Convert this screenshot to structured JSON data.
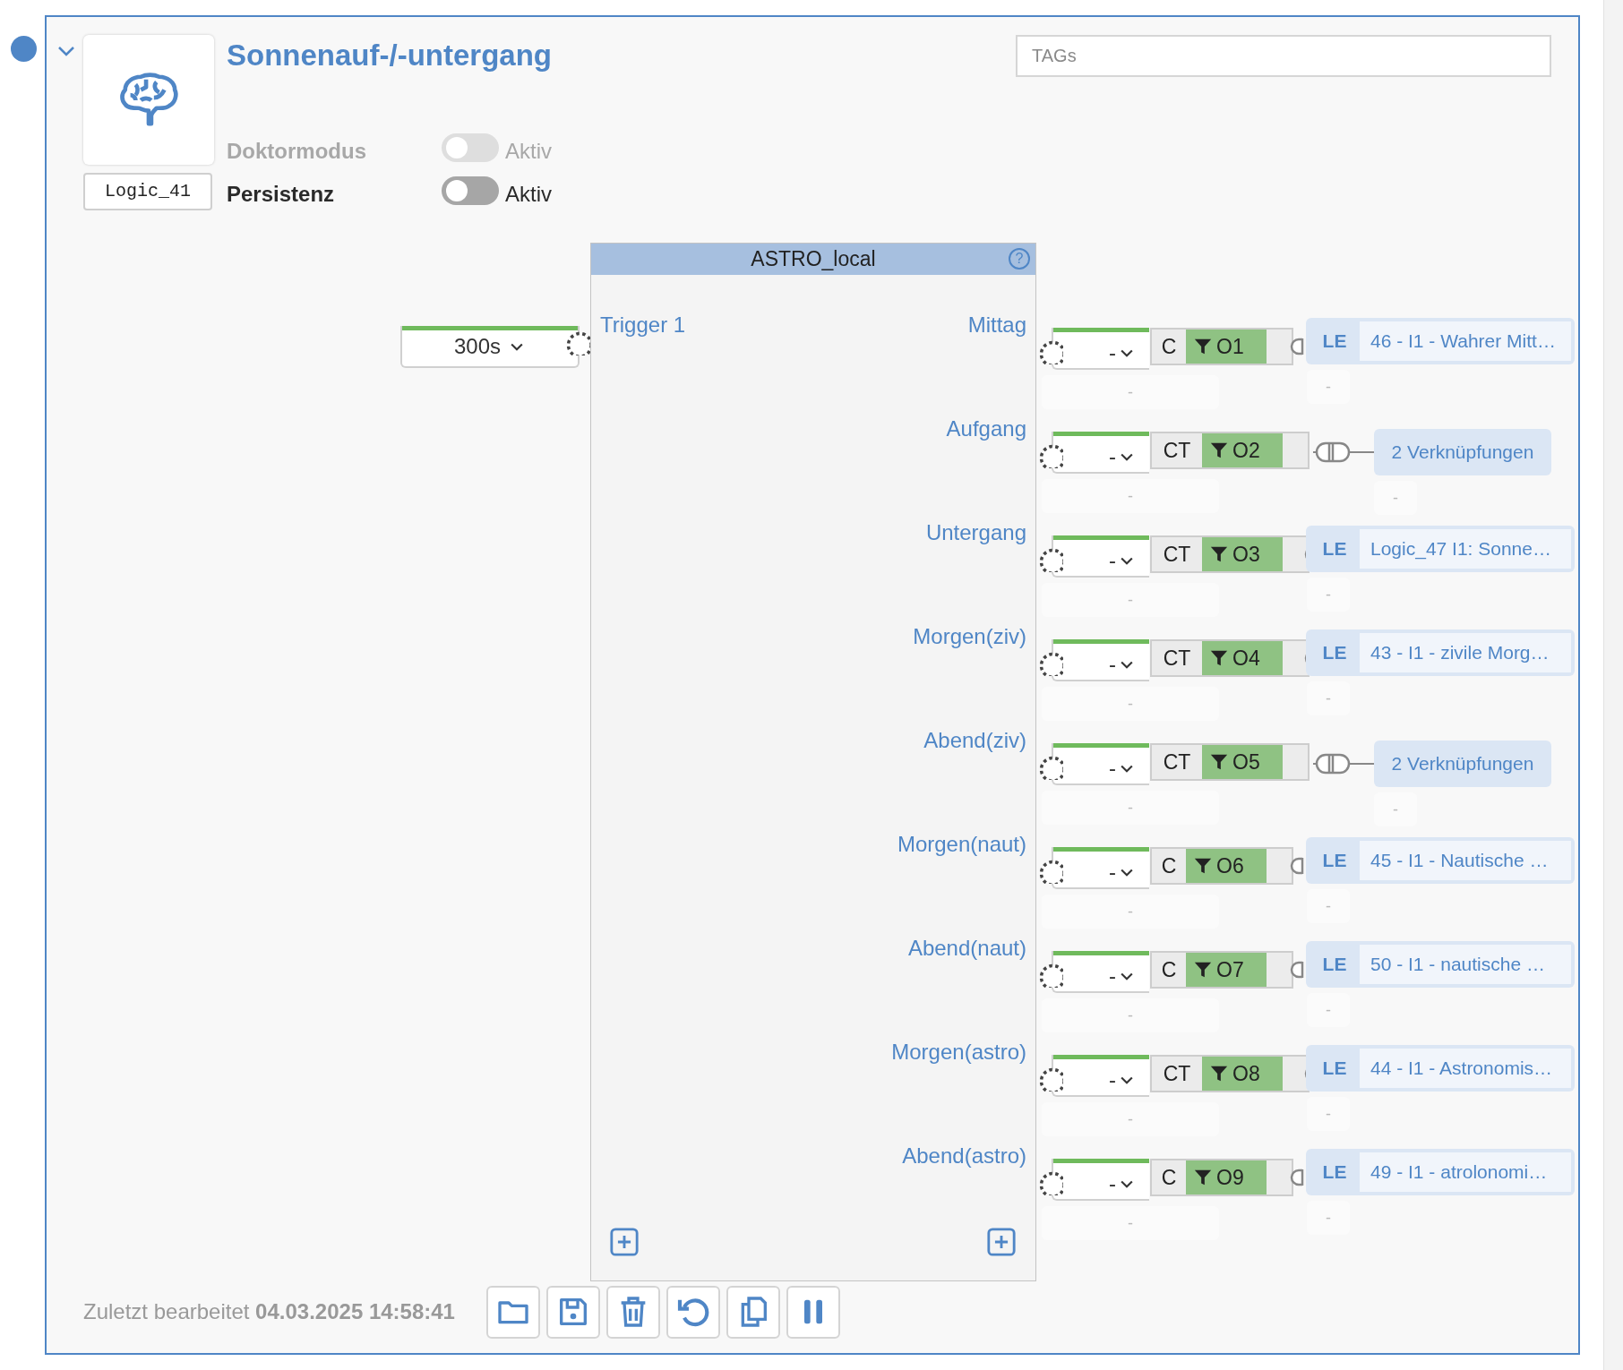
{
  "logic": {
    "title": "Sonnenauf-/-untergang",
    "id": "Logic_41",
    "expanded": true,
    "tags": {
      "placeholder": "TAGs"
    },
    "options": [
      {
        "label": "Doktormodus",
        "toggle_label": "Aktiv",
        "on": false,
        "disabled": true
      },
      {
        "label": "Persistenz",
        "toggle_label": "Aktiv",
        "on": false,
        "disabled": false
      }
    ]
  },
  "block": {
    "title": "ASTRO_local",
    "help": "?",
    "inputs": [
      {
        "label": "Trigger 1",
        "value": "300s"
      }
    ],
    "outputs": [
      {
        "label": "Mittag",
        "value": "-",
        "value_sub": "-",
        "mode": "C",
        "port": "O1",
        "link": {
          "kind": "le",
          "tag": "LE",
          "text": "46 - I1 - Wahrer Mitt…"
        },
        "link_sub": "-"
      },
      {
        "label": "Aufgang",
        "value": "-",
        "value_sub": "-",
        "mode": "CT",
        "port": "O2",
        "link": {
          "kind": "count",
          "text": "2 Verknüpfungen"
        },
        "link_sub": "-"
      },
      {
        "label": "Untergang",
        "value": "-",
        "value_sub": "-",
        "mode": "CT",
        "port": "O3",
        "link": {
          "kind": "le",
          "tag": "LE",
          "text": "Logic_47 I1: Sonne…"
        },
        "link_sub": "-"
      },
      {
        "label": "Morgen(ziv)",
        "value": "-",
        "value_sub": "-",
        "mode": "CT",
        "port": "O4",
        "link": {
          "kind": "le",
          "tag": "LE",
          "text": "43 - I1 - zivile Morg…"
        },
        "link_sub": "-"
      },
      {
        "label": "Abend(ziv)",
        "value": "-",
        "value_sub": "-",
        "mode": "CT",
        "port": "O5",
        "link": {
          "kind": "count",
          "text": "2 Verknüpfungen"
        },
        "link_sub": "-"
      },
      {
        "label": "Morgen(naut)",
        "value": "-",
        "value_sub": "-",
        "mode": "C",
        "port": "O6",
        "link": {
          "kind": "le",
          "tag": "LE",
          "text": "45 - I1 - Nautische …"
        },
        "link_sub": "-"
      },
      {
        "label": "Abend(naut)",
        "value": "-",
        "value_sub": "-",
        "mode": "C",
        "port": "O7",
        "link": {
          "kind": "le",
          "tag": "LE",
          "text": "50 - I1 - nautische …"
        },
        "link_sub": "-"
      },
      {
        "label": "Morgen(astro)",
        "value": "-",
        "value_sub": "-",
        "mode": "CT",
        "port": "O8",
        "link": {
          "kind": "le",
          "tag": "LE",
          "text": "44 - I1 - Astronomis…"
        },
        "link_sub": "-"
      },
      {
        "label": "Abend(astro)",
        "value": "-",
        "value_sub": "-",
        "mode": "C",
        "port": "O9",
        "link": {
          "kind": "le",
          "tag": "LE",
          "text": "49 - I1 - atrolonomi…"
        },
        "link_sub": "-"
      }
    ]
  },
  "footer": {
    "text": "Zuletzt bearbeitet **04.03.2025 14:58:41**",
    "actions": [
      {
        "kind": "open"
      },
      {
        "kind": "save"
      },
      {
        "kind": "delete"
      },
      {
        "kind": "undo"
      },
      {
        "kind": "copy"
      },
      {
        "kind": "pause"
      }
    ]
  }
}
